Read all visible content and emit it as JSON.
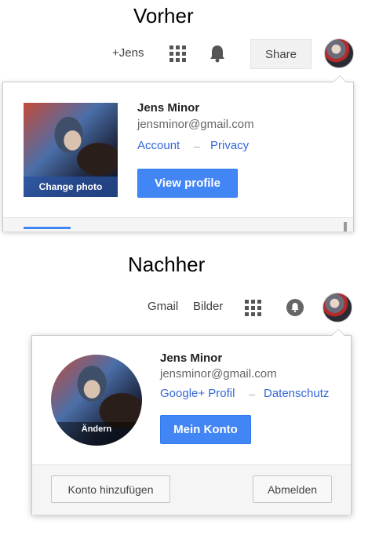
{
  "before": {
    "heading": "Vorher",
    "topbar": {
      "profile_link": "+Jens",
      "share_label": "Share"
    },
    "panel": {
      "photo_label": "Change photo",
      "name": "Jens Minor",
      "email": "jensminor@gmail.com",
      "account_link": "Account",
      "separator": "–",
      "privacy_link": "Privacy",
      "view_profile_label": "View profile"
    }
  },
  "after": {
    "heading": "Nachher",
    "topbar": {
      "gmail_link": "Gmail",
      "images_link": "Bilder"
    },
    "panel": {
      "photo_label": "Ändern",
      "name": "Jens Minor",
      "email": "jensminor@gmail.com",
      "profile_link": "Google+ Profil",
      "separator": "–",
      "privacy_link": "Datenschutz",
      "my_account_label": "Mein Konto",
      "add_account_label": "Konto hinzufügen",
      "sign_out_label": "Abmelden"
    }
  }
}
